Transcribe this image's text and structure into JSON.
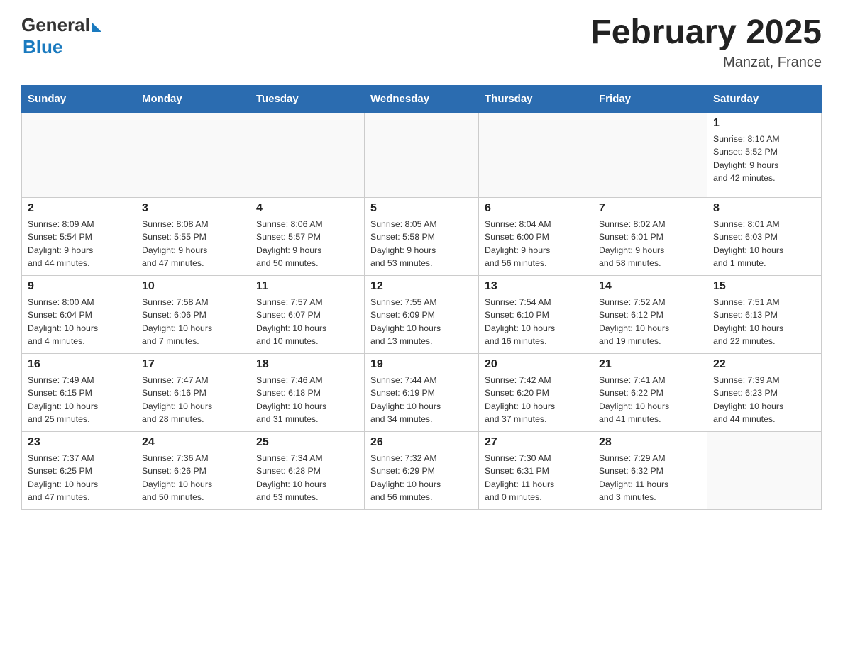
{
  "header": {
    "logo_general": "General",
    "logo_blue": "Blue",
    "month_year": "February 2025",
    "location": "Manzat, France"
  },
  "weekdays": [
    "Sunday",
    "Monday",
    "Tuesday",
    "Wednesday",
    "Thursday",
    "Friday",
    "Saturday"
  ],
  "weeks": [
    [
      {
        "day": "",
        "info": ""
      },
      {
        "day": "",
        "info": ""
      },
      {
        "day": "",
        "info": ""
      },
      {
        "day": "",
        "info": ""
      },
      {
        "day": "",
        "info": ""
      },
      {
        "day": "",
        "info": ""
      },
      {
        "day": "1",
        "info": "Sunrise: 8:10 AM\nSunset: 5:52 PM\nDaylight: 9 hours\nand 42 minutes."
      }
    ],
    [
      {
        "day": "2",
        "info": "Sunrise: 8:09 AM\nSunset: 5:54 PM\nDaylight: 9 hours\nand 44 minutes."
      },
      {
        "day": "3",
        "info": "Sunrise: 8:08 AM\nSunset: 5:55 PM\nDaylight: 9 hours\nand 47 minutes."
      },
      {
        "day": "4",
        "info": "Sunrise: 8:06 AM\nSunset: 5:57 PM\nDaylight: 9 hours\nand 50 minutes."
      },
      {
        "day": "5",
        "info": "Sunrise: 8:05 AM\nSunset: 5:58 PM\nDaylight: 9 hours\nand 53 minutes."
      },
      {
        "day": "6",
        "info": "Sunrise: 8:04 AM\nSunset: 6:00 PM\nDaylight: 9 hours\nand 56 minutes."
      },
      {
        "day": "7",
        "info": "Sunrise: 8:02 AM\nSunset: 6:01 PM\nDaylight: 9 hours\nand 58 minutes."
      },
      {
        "day": "8",
        "info": "Sunrise: 8:01 AM\nSunset: 6:03 PM\nDaylight: 10 hours\nand 1 minute."
      }
    ],
    [
      {
        "day": "9",
        "info": "Sunrise: 8:00 AM\nSunset: 6:04 PM\nDaylight: 10 hours\nand 4 minutes."
      },
      {
        "day": "10",
        "info": "Sunrise: 7:58 AM\nSunset: 6:06 PM\nDaylight: 10 hours\nand 7 minutes."
      },
      {
        "day": "11",
        "info": "Sunrise: 7:57 AM\nSunset: 6:07 PM\nDaylight: 10 hours\nand 10 minutes."
      },
      {
        "day": "12",
        "info": "Sunrise: 7:55 AM\nSunset: 6:09 PM\nDaylight: 10 hours\nand 13 minutes."
      },
      {
        "day": "13",
        "info": "Sunrise: 7:54 AM\nSunset: 6:10 PM\nDaylight: 10 hours\nand 16 minutes."
      },
      {
        "day": "14",
        "info": "Sunrise: 7:52 AM\nSunset: 6:12 PM\nDaylight: 10 hours\nand 19 minutes."
      },
      {
        "day": "15",
        "info": "Sunrise: 7:51 AM\nSunset: 6:13 PM\nDaylight: 10 hours\nand 22 minutes."
      }
    ],
    [
      {
        "day": "16",
        "info": "Sunrise: 7:49 AM\nSunset: 6:15 PM\nDaylight: 10 hours\nand 25 minutes."
      },
      {
        "day": "17",
        "info": "Sunrise: 7:47 AM\nSunset: 6:16 PM\nDaylight: 10 hours\nand 28 minutes."
      },
      {
        "day": "18",
        "info": "Sunrise: 7:46 AM\nSunset: 6:18 PM\nDaylight: 10 hours\nand 31 minutes."
      },
      {
        "day": "19",
        "info": "Sunrise: 7:44 AM\nSunset: 6:19 PM\nDaylight: 10 hours\nand 34 minutes."
      },
      {
        "day": "20",
        "info": "Sunrise: 7:42 AM\nSunset: 6:20 PM\nDaylight: 10 hours\nand 37 minutes."
      },
      {
        "day": "21",
        "info": "Sunrise: 7:41 AM\nSunset: 6:22 PM\nDaylight: 10 hours\nand 41 minutes."
      },
      {
        "day": "22",
        "info": "Sunrise: 7:39 AM\nSunset: 6:23 PM\nDaylight: 10 hours\nand 44 minutes."
      }
    ],
    [
      {
        "day": "23",
        "info": "Sunrise: 7:37 AM\nSunset: 6:25 PM\nDaylight: 10 hours\nand 47 minutes."
      },
      {
        "day": "24",
        "info": "Sunrise: 7:36 AM\nSunset: 6:26 PM\nDaylight: 10 hours\nand 50 minutes."
      },
      {
        "day": "25",
        "info": "Sunrise: 7:34 AM\nSunset: 6:28 PM\nDaylight: 10 hours\nand 53 minutes."
      },
      {
        "day": "26",
        "info": "Sunrise: 7:32 AM\nSunset: 6:29 PM\nDaylight: 10 hours\nand 56 minutes."
      },
      {
        "day": "27",
        "info": "Sunrise: 7:30 AM\nSunset: 6:31 PM\nDaylight: 11 hours\nand 0 minutes."
      },
      {
        "day": "28",
        "info": "Sunrise: 7:29 AM\nSunset: 6:32 PM\nDaylight: 11 hours\nand 3 minutes."
      },
      {
        "day": "",
        "info": ""
      }
    ]
  ]
}
